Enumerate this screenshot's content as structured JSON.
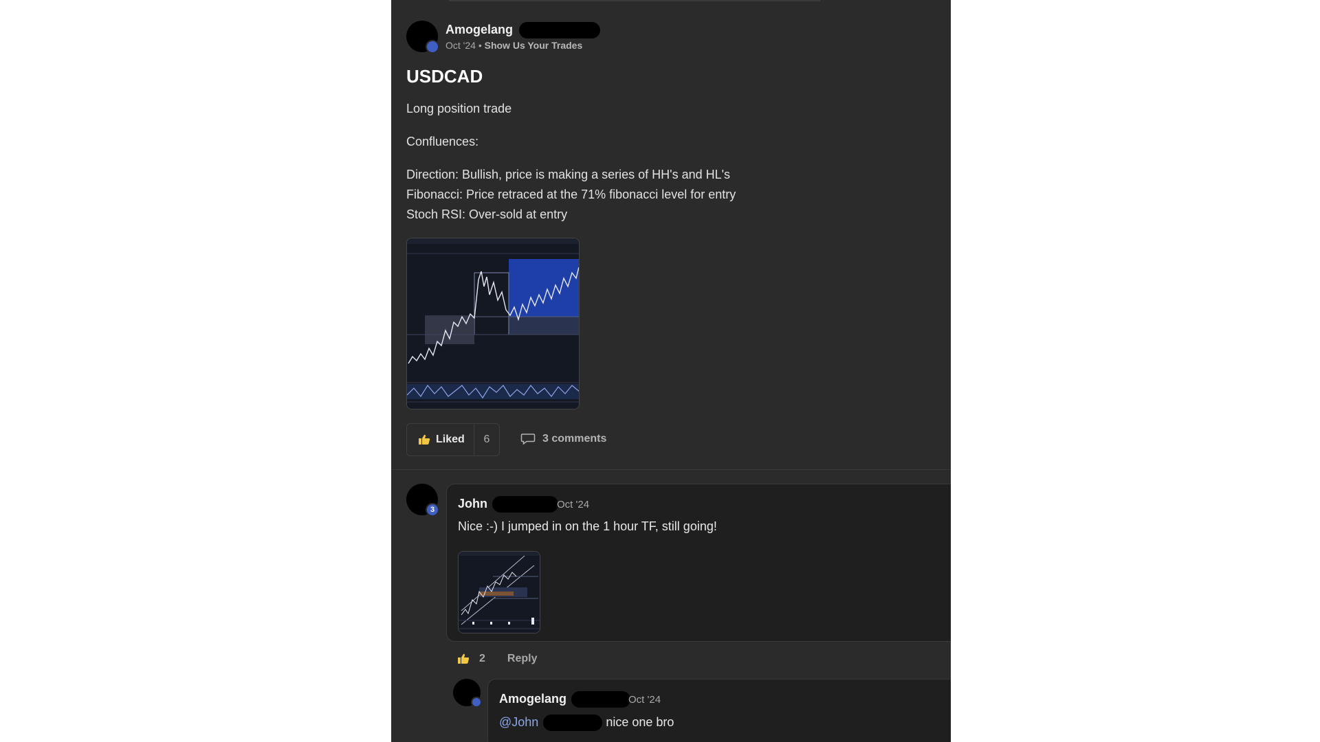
{
  "post": {
    "author": "Amogelang",
    "date": "Oct '24",
    "separator": "•",
    "category": "Show Us Your Trades",
    "title": "USDCAD",
    "body": [
      "Long position trade",
      "Confluences:"
    ],
    "details": [
      "Direction: Bullish, price is making a series of HH's and HL's",
      "Fibonacci: Price retraced at the 71% fibonacci level for entry",
      "Stoch RSI: Over-sold at entry"
    ],
    "liked_label": "Liked",
    "like_count": "6",
    "comments_label": "3 comments"
  },
  "comments": [
    {
      "author": "John",
      "level": "3",
      "date": "Oct '24",
      "text": "Nice :-) I jumped in on the 1 hour TF, still going!",
      "like_count": "2",
      "reply_label": "Reply"
    },
    {
      "author": "Amogelang",
      "date": "Oct '24",
      "mention": "@John",
      "text": "nice one bro"
    }
  ],
  "colors": {
    "panel_bg": "#2b2b2b",
    "comment_bg": "#1f1f1f",
    "mention": "#8aa7ee",
    "badge": "#3f5fc4",
    "like_icon": "#f2c744"
  }
}
